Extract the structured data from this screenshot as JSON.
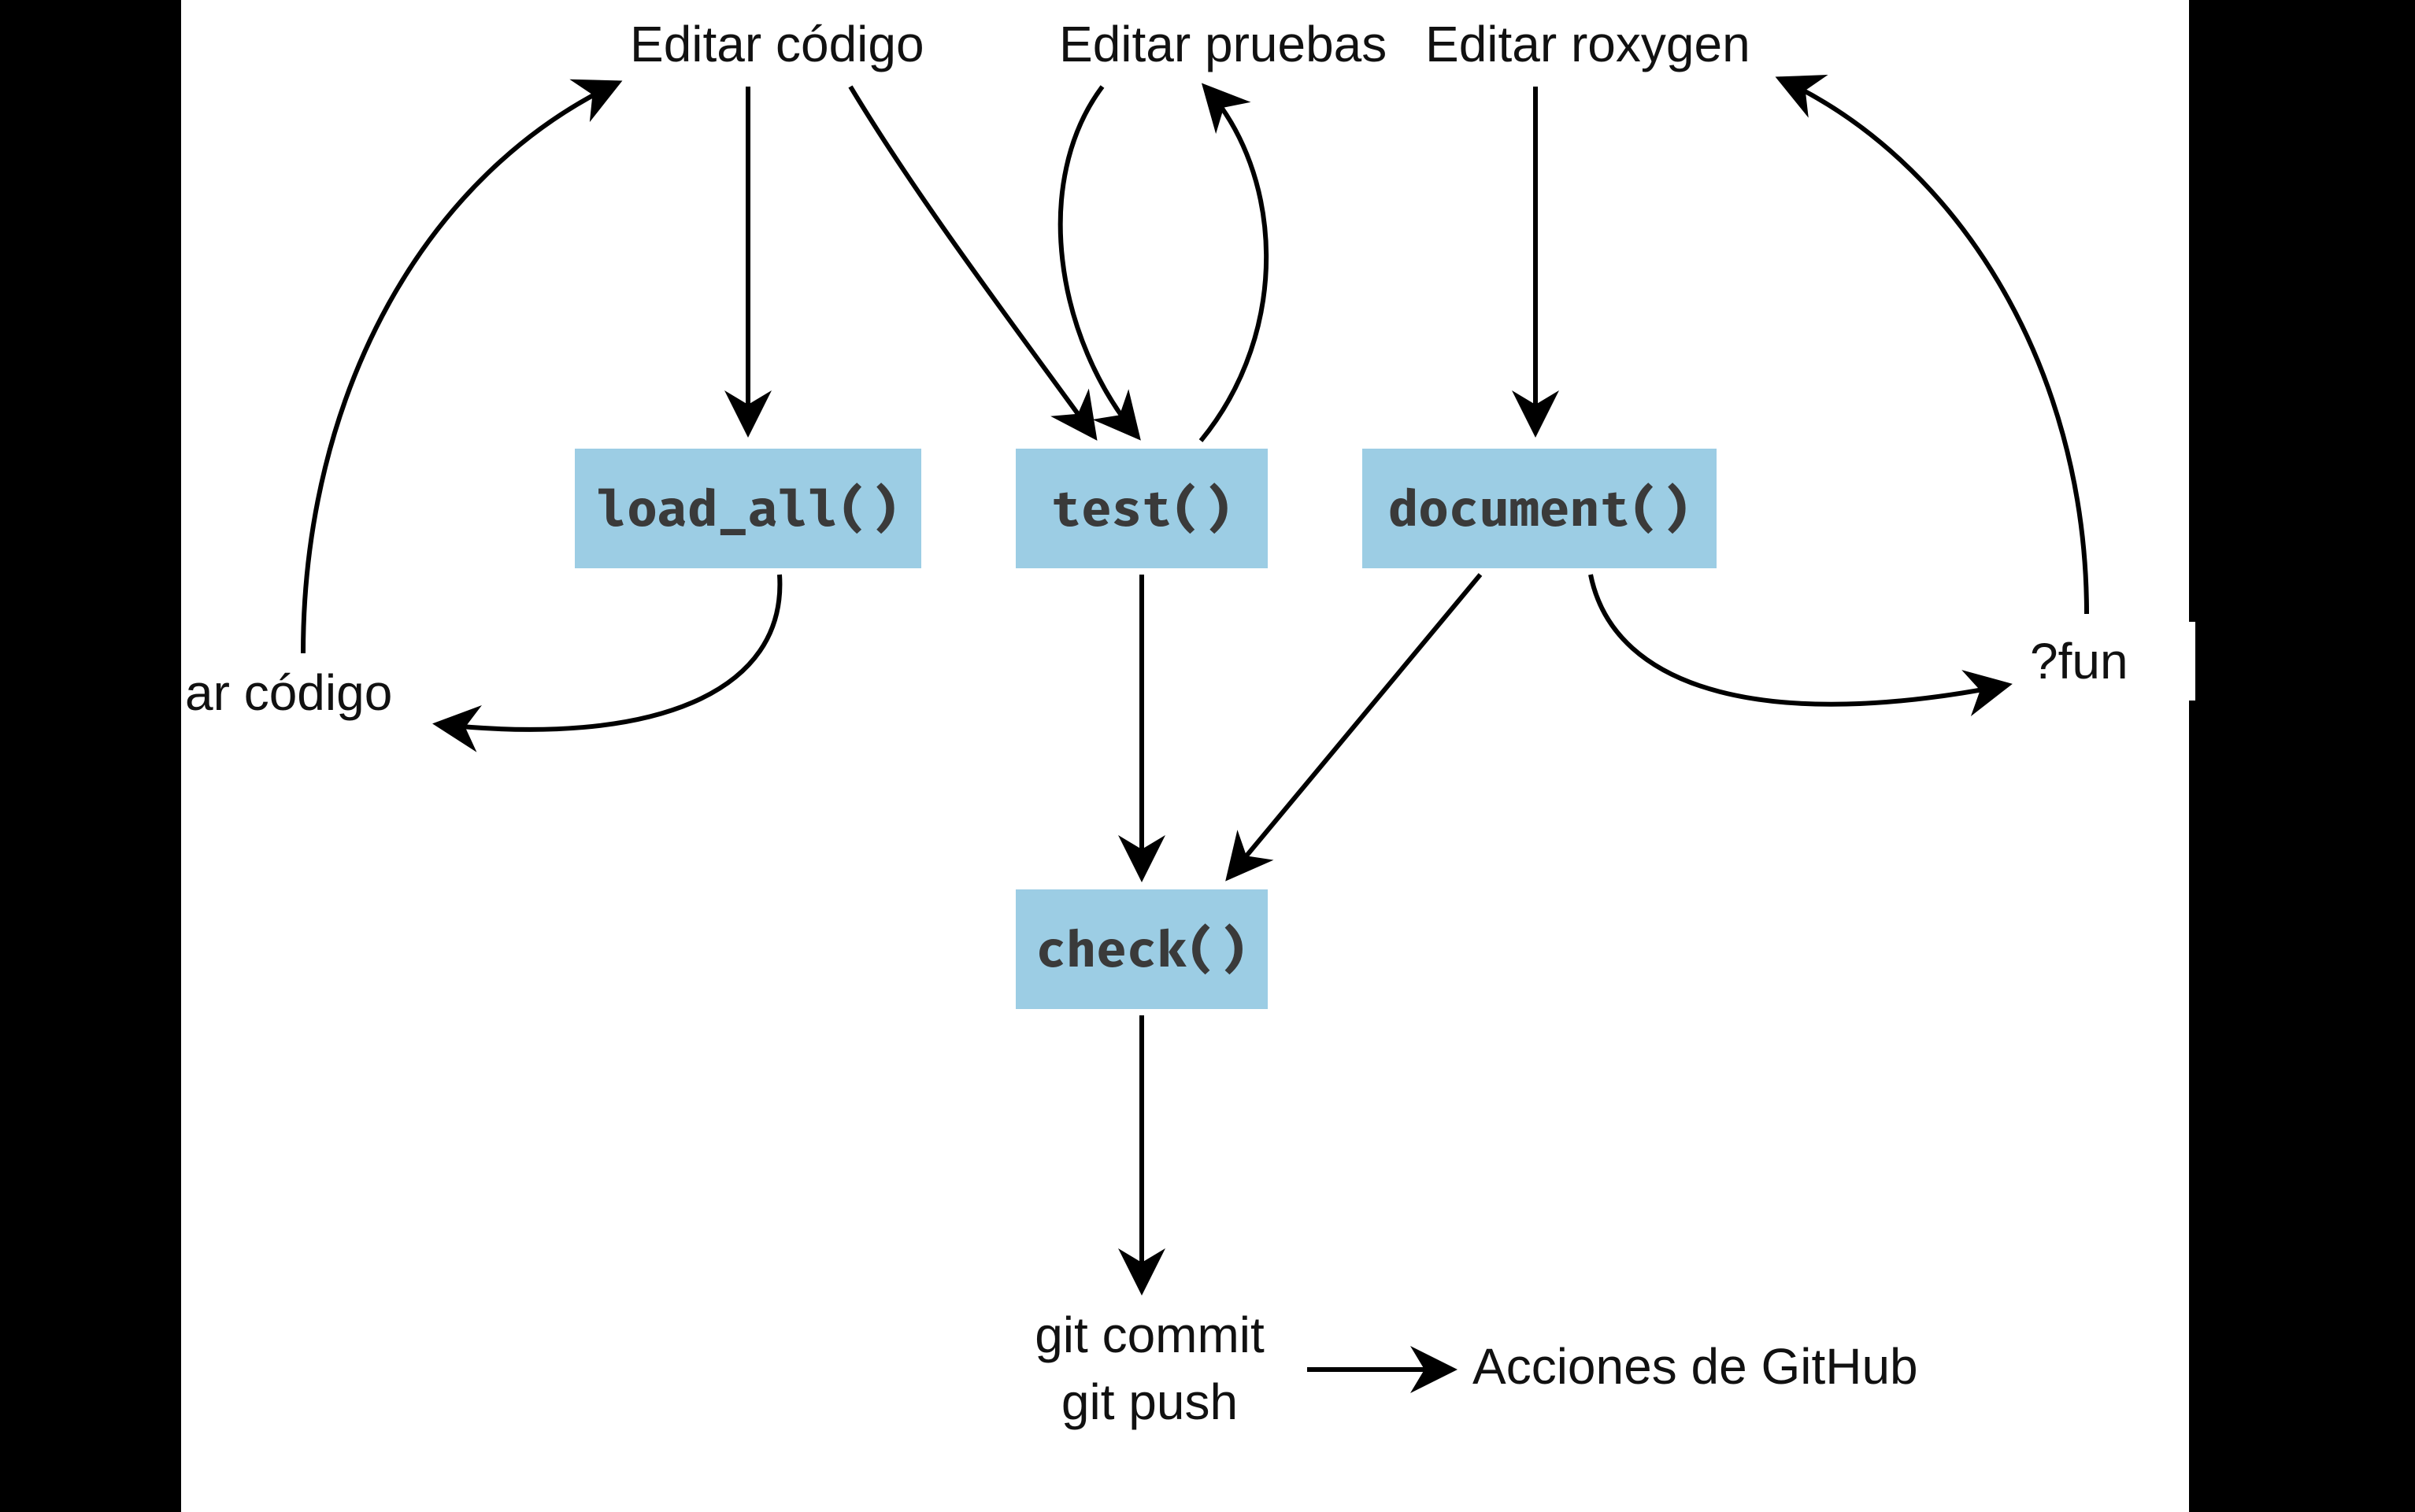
{
  "headers": {
    "edit_code": "Editar código",
    "edit_tests": "Editar pruebas",
    "edit_roxygen": "Editar roxygen"
  },
  "boxes": {
    "load_all": "load_all()",
    "test": "test()",
    "document": "document()",
    "check": "check()"
  },
  "side_labels": {
    "run_code_fragment": "ar código",
    "fun_help": "?fun"
  },
  "bottom": {
    "git_commit": "git commit",
    "git_push": "git push",
    "github_actions": "Acciones de GitHub"
  },
  "colors": {
    "box_bg": "#9ccde4",
    "text": "#111111",
    "mono_text": "#3a3a3a",
    "page_bg": "#000000",
    "canvas_bg": "#ffffff"
  }
}
